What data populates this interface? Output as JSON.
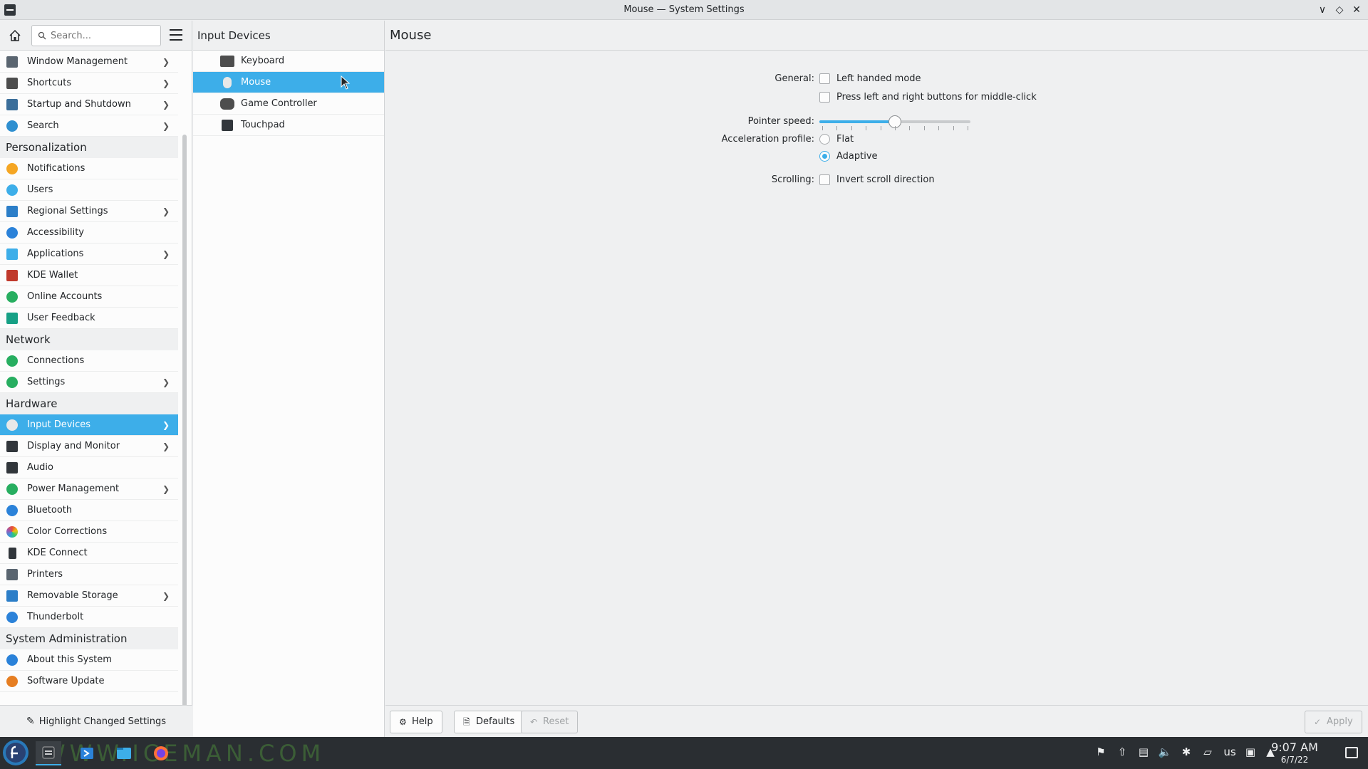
{
  "window": {
    "title": "Mouse — System Settings"
  },
  "search": {
    "placeholder": "Search..."
  },
  "sidebar": {
    "items_top": [
      {
        "label": "Window Management",
        "icon": "window-icon",
        "color": "#5a6570",
        "chevron": true
      },
      {
        "label": "Shortcuts",
        "icon": "keyboard-icon",
        "color": "#4d4d4d",
        "chevron": true
      },
      {
        "label": "Startup and Shutdown",
        "icon": "startup-icon",
        "color": "#3b6e9a",
        "chevron": true
      },
      {
        "label": "Search",
        "icon": "search-icon",
        "color": "#2f8fd0",
        "chevron": true
      }
    ],
    "personalization": {
      "header": "Personalization",
      "items": [
        {
          "label": "Notifications",
          "icon": "bell-icon",
          "color": "#f5a623",
          "chevron": false
        },
        {
          "label": "Users",
          "icon": "users-icon",
          "color": "#3daee9",
          "chevron": false
        },
        {
          "label": "Regional Settings",
          "icon": "flag-icon",
          "color": "#2c7ec8",
          "chevron": true
        },
        {
          "label": "Accessibility",
          "icon": "accessibility-icon",
          "color": "#2b82d9",
          "chevron": false
        },
        {
          "label": "Applications",
          "icon": "applications-icon",
          "color": "#3daee9",
          "chevron": true
        },
        {
          "label": "KDE Wallet",
          "icon": "wallet-icon",
          "color": "#c0392b",
          "chevron": false
        },
        {
          "label": "Online Accounts",
          "icon": "globe-icon",
          "color": "#27ae60",
          "chevron": false
        },
        {
          "label": "User Feedback",
          "icon": "feedback-icon",
          "color": "#16a085",
          "chevron": false
        }
      ]
    },
    "network": {
      "header": "Network",
      "items": [
        {
          "label": "Connections",
          "icon": "globe-icon",
          "color": "#27ae60",
          "chevron": false
        },
        {
          "label": "Settings",
          "icon": "network-settings-icon",
          "color": "#27ae60",
          "chevron": true
        }
      ]
    },
    "hardware": {
      "header": "Hardware",
      "items": [
        {
          "label": "Input Devices",
          "icon": "mouse-icon",
          "color": "#e8e8e8",
          "chevron": true,
          "selected": true
        },
        {
          "label": "Display and Monitor",
          "icon": "monitor-icon",
          "color": "#31363b",
          "chevron": true
        },
        {
          "label": "Audio",
          "icon": "speaker-icon",
          "color": "#31363b",
          "chevron": false
        },
        {
          "label": "Power Management",
          "icon": "power-icon",
          "color": "#27ae60",
          "chevron": true
        },
        {
          "label": "Bluetooth",
          "icon": "bluetooth-icon",
          "color": "#2b82d9",
          "chevron": false
        },
        {
          "label": "Color Corrections",
          "icon": "color-wheel-icon",
          "color": "#8e44ad",
          "chevron": false
        },
        {
          "label": "KDE Connect",
          "icon": "phone-icon",
          "color": "#31363b",
          "chevron": false
        },
        {
          "label": "Printers",
          "icon": "printer-icon",
          "color": "#5a6570",
          "chevron": false
        },
        {
          "label": "Removable Storage",
          "icon": "usb-icon",
          "color": "#2c7ec8",
          "chevron": true
        },
        {
          "label": "Thunderbolt",
          "icon": "thunderbolt-icon",
          "color": "#2b82d9",
          "chevron": false
        }
      ]
    },
    "sysadmin": {
      "header": "System Administration",
      "items": [
        {
          "label": "About this System",
          "icon": "info-icon",
          "color": "#2b82d9",
          "chevron": false
        },
        {
          "label": "Software Update",
          "icon": "update-icon",
          "color": "#e67e22",
          "chevron": false
        }
      ]
    },
    "bottom_label": "Highlight Changed Settings"
  },
  "middle": {
    "title": "Input Devices",
    "items": [
      {
        "label": "Keyboard",
        "icon": "keyboard-icon",
        "color": "#4d4d4d"
      },
      {
        "label": "Mouse",
        "icon": "mouse-icon",
        "color": "#e8e8e8",
        "selected": true
      },
      {
        "label": "Game Controller",
        "icon": "gamepad-icon",
        "color": "#4d4d4d"
      },
      {
        "label": "Touchpad",
        "icon": "touchpad-icon",
        "color": "#31363b"
      }
    ]
  },
  "main": {
    "title": "Mouse",
    "general_label": "General:",
    "left_handed": "Left handed mode",
    "middle_click": "Press left and right buttons for middle-click",
    "pointer_speed_label": "Pointer speed:",
    "pointer_speed_value": 0.5,
    "pointer_speed_ticks": 11,
    "accel_label": "Acceleration profile:",
    "accel_flat": "Flat",
    "accel_adaptive": "Adaptive",
    "scrolling_label": "Scrolling:",
    "invert_scroll": "Invert scroll direction",
    "buttons": {
      "help": "Help",
      "defaults": "Defaults",
      "reset": "Reset",
      "apply": "Apply"
    }
  },
  "taskbar": {
    "keyboard_layout": "us",
    "time": "9:07 AM",
    "date": "6/7/22"
  },
  "colors": {
    "accent": "#3daee9",
    "taskbar": "#2a2e32"
  }
}
